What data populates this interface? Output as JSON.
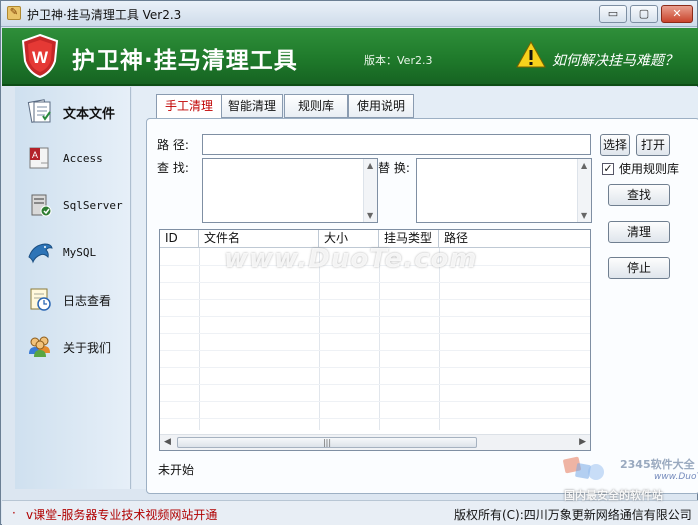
{
  "window": {
    "title": "护卫神·挂马清理工具 Ver2.3",
    "controls": {
      "minimize": "▭",
      "maximize": "▢",
      "close": "✕"
    }
  },
  "banner": {
    "title": "护卫神·挂马清理工具",
    "version": "版本：Ver2.3",
    "howto_link": "如何解决挂马难题？",
    "shield_letter": "W"
  },
  "sidebar": {
    "items": [
      {
        "label": "文本文件",
        "icon": "text-file-icon"
      },
      {
        "label": "Access",
        "icon": "access-db-icon"
      },
      {
        "label": "SqlServer",
        "icon": "sqlserver-icon"
      },
      {
        "label": "MySQL",
        "icon": "mysql-dolphin-icon"
      },
      {
        "label": "日志查看",
        "icon": "log-clock-icon"
      },
      {
        "label": "关于我们",
        "icon": "users-icon"
      }
    ]
  },
  "tabs": [
    {
      "label": "手工清理",
      "active": true
    },
    {
      "label": "智能清理",
      "active": false
    },
    {
      "label": "规则库",
      "active": false
    },
    {
      "label": "使用说明",
      "active": false
    }
  ],
  "form": {
    "path_label": "路 径:",
    "path_value": "",
    "find_label": "查 找:",
    "replace_label": "替 换:",
    "find_value": "",
    "replace_value": "",
    "select_button": "选择",
    "open_button": "打开",
    "use_rules_label": "使用规则库",
    "use_rules_checked": true,
    "find_button": "查找",
    "clean_button": "清理",
    "stop_button": "停止"
  },
  "results_table": {
    "columns": [
      "ID",
      "文件名",
      "大小",
      "挂马类型",
      "路径"
    ],
    "rows": []
  },
  "status": "未开始",
  "footer": {
    "ad_text": "v课堂-服务器专业技术视频网站开通",
    "copyright": "版权所有(C):四川万象更新网络通信有限公司"
  },
  "watermarks": {
    "center": "www.DuoTe.com",
    "corner_brand": "2345软件大全",
    "corner_url": "www.DuoTe.com",
    "corner_slogan": "国内最安全的软件站"
  },
  "colors": {
    "banner_green": "#1f7a2b",
    "active_tab_text": "#c00000",
    "ad_text": "#b00000"
  }
}
